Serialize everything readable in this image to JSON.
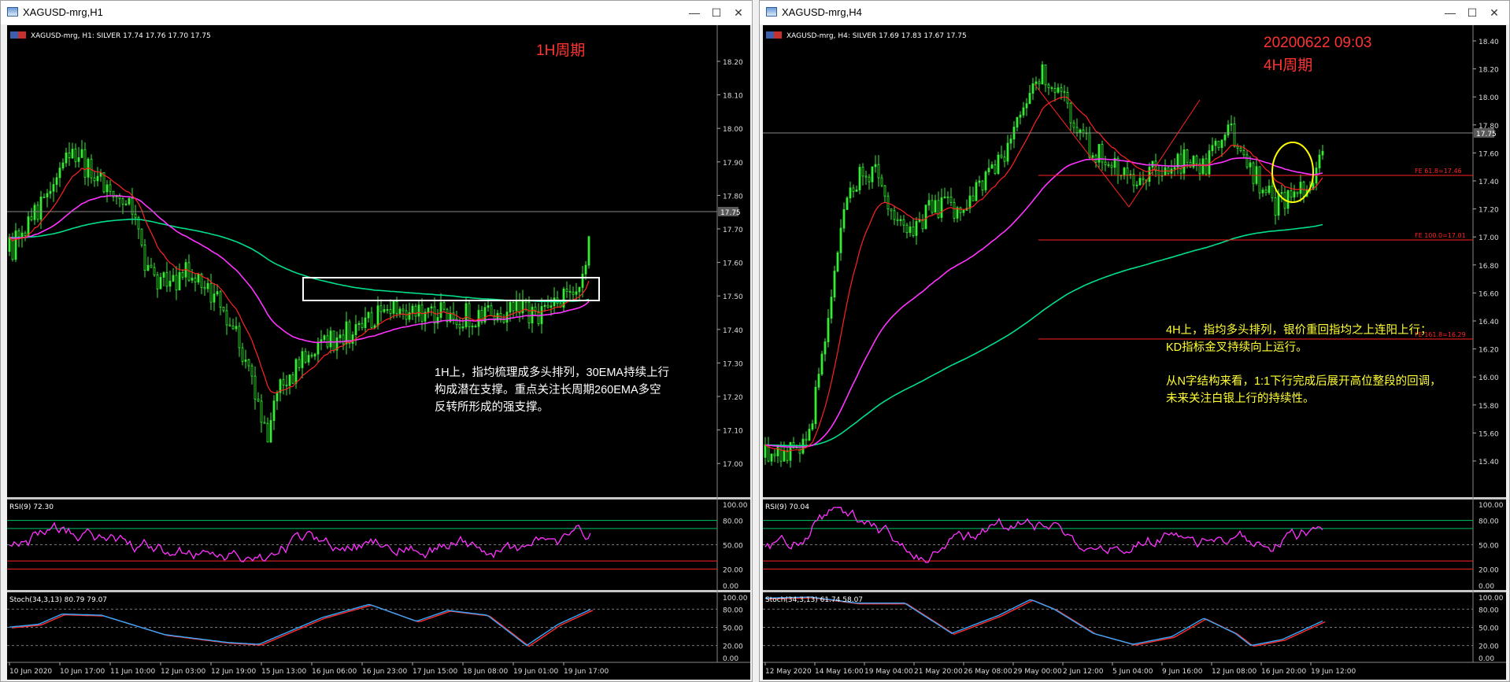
{
  "windows": [
    {
      "title": "XAGUSD-mrg,H1",
      "header": "XAGUSD-mrg, H1:  SILVER   17.74  17.76  17.70  17.75",
      "period_label": "1H周期",
      "price_labels": [
        "18.20",
        "18.10",
        "18.00",
        "17.90",
        "17.80",
        "17.70",
        "17.60",
        "17.50",
        "17.40",
        "17.30",
        "17.20",
        "17.10",
        "17.00"
      ],
      "current_price": "17.75",
      "annotation": [
        "1H上，指均梳理成多头排列，30EMA持续上行",
        "构成潜在支撑。重点关注长周期260EMA多空",
        "反转所形成的强支撑。"
      ],
      "rsi_label": "RSI(9) 72.30",
      "rsi_levels": [
        "100.00",
        "80.00",
        "50.00",
        "20.00",
        "0.00"
      ],
      "stoch_label": "Stoch(34,3,13) 80.79 79.07",
      "stoch_levels": [
        "100.00",
        "80.00",
        "50.00",
        "20.00",
        "0.00"
      ],
      "time_labels": [
        "10 Jun 2020",
        "10 Jun 17:00",
        "11 Jun 10:00",
        "12 Jun 03:00",
        "12 Jun 19:00",
        "15 Jun 13:00",
        "16 Jun 06:00",
        "16 Jun 23:00",
        "17 Jun 15:00",
        "18 Jun 08:00",
        "19 Jun 01:00",
        "19 Jun 17:00"
      ]
    },
    {
      "title": "XAGUSD-mrg,H4",
      "header": "XAGUSD-mrg, H4:  SILVER   17.69  17.83  17.67  17.75",
      "timestamp": "20200622 09:03",
      "period_label": "4H周期",
      "price_labels": [
        "18.40",
        "18.20",
        "18.00",
        "17.80",
        "17.60",
        "17.40",
        "17.20",
        "17.00",
        "16.80",
        "16.60",
        "16.40",
        "16.20",
        "16.00",
        "15.80",
        "15.60",
        "15.40"
      ],
      "current_price": "17.75",
      "fibo": [
        "FE 61.8=17.46",
        "FE 100.0=17.01",
        "FE 161.8=16.29"
      ],
      "annotation_1": [
        "4H上，指均多头排列，银价重回指均之上连阳上行；",
        "KD指标金叉持续向上运行。"
      ],
      "annotation_2": [
        "从N字结构来看，1:1下行完成后展开高位整段的回调，",
        "未来关注白银上行的持续性。"
      ],
      "rsi_label": "RSI(9) 70.04",
      "rsi_levels": [
        "100.00",
        "80.00",
        "50.00",
        "20.00",
        "0.00"
      ],
      "stoch_label": "Stoch(34,3,13) 61.74 58.07",
      "stoch_levels": [
        "100.00",
        "80.00",
        "50.00",
        "20.00",
        "0.00"
      ],
      "time_labels": [
        "12 May 2020",
        "14 May 16:00",
        "19 May 04:00",
        "21 May 20:00",
        "26 May 08:00",
        "29 May 00:00",
        "2 Jun 12:00",
        "5 Jun 04:00",
        "9 Jun 16:00",
        "12 Jun 08:00",
        "16 Jun 20:00",
        "19 Jun 12:00"
      ]
    }
  ],
  "colors": {
    "up": "#33ee33",
    "ema_fast": "#ff2222",
    "ema_mid": "#ff33ff",
    "ema_slow": "#00e08a",
    "rsi": "#ff33ff",
    "stoch_k": "#35a8ff",
    "stoch_d": "#ff3030",
    "grid": "#3a3a3a",
    "annotation_white": "#ffffff",
    "annotation_yellow": "#ffff33",
    "title_red": "#ff3333"
  }
}
